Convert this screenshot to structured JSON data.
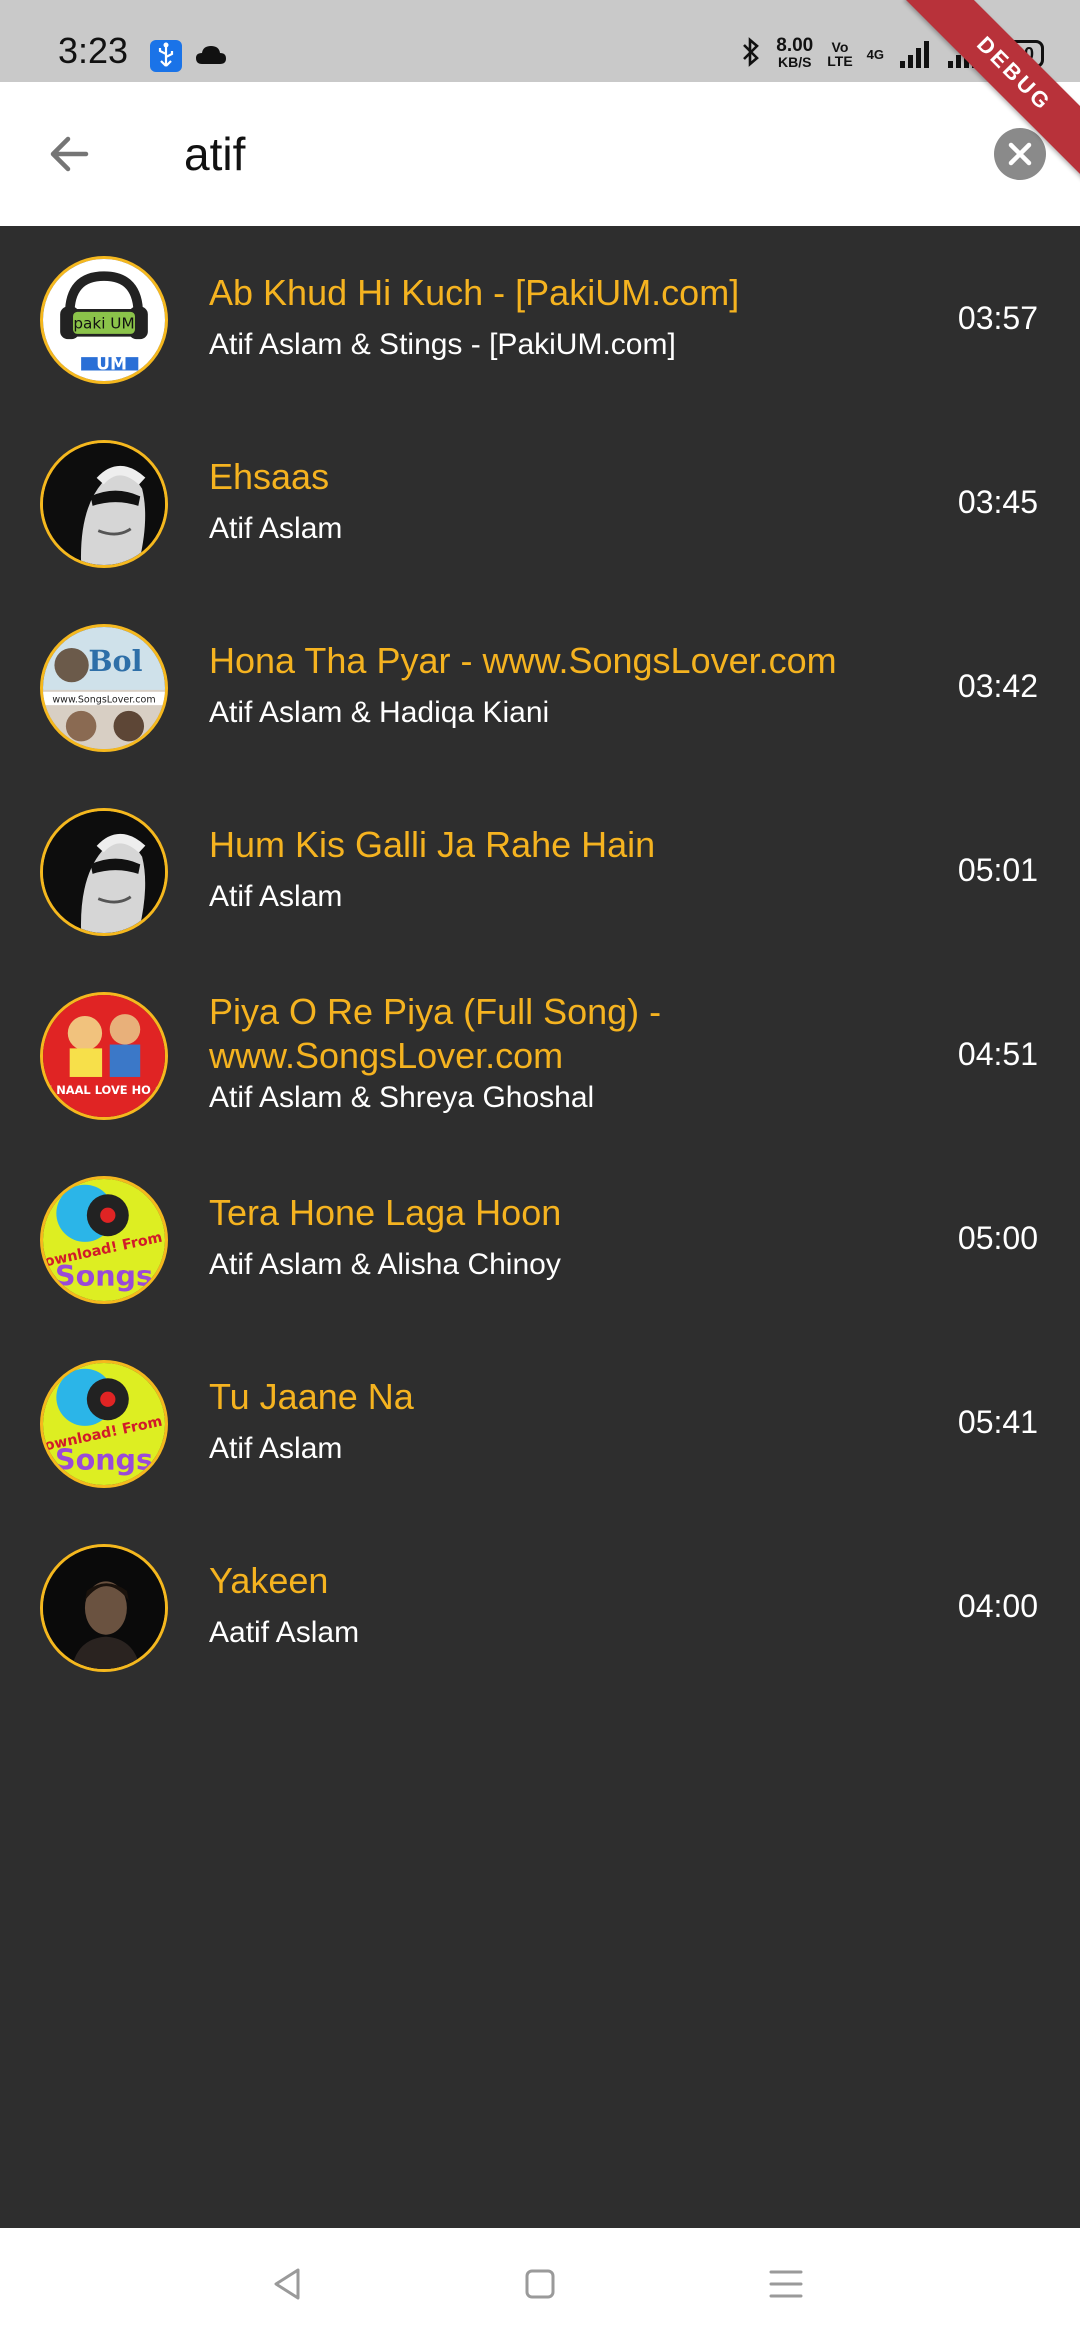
{
  "status_bar": {
    "time": "3:23",
    "speed_value": "8.00",
    "speed_unit": "KB/S",
    "volte_top": "Vo",
    "volte_bottom": "LTE",
    "network": "4G",
    "battery": "100",
    "icons": [
      "usb-icon",
      "cloud-icon",
      "bluetooth-icon",
      "signal-icon",
      "battery-icon"
    ]
  },
  "debug_banner": "DEBUG",
  "search": {
    "query": "atif",
    "back_icon": "arrow-left-icon",
    "clear_icon": "close-icon"
  },
  "songs": [
    {
      "title": "Ab Khud Hi Kuch - [PakiUM.com]",
      "artist": "Atif Aslam & Stings - [PakiUM.com]",
      "duration": "03:57",
      "art_text": "paki UM"
    },
    {
      "title": "Ehsaas",
      "artist": "Atif Aslam",
      "duration": "03:45"
    },
    {
      "title": "Hona Tha Pyar - www.SongsLover.com",
      "artist": "Atif Aslam & Hadiqa Kiani",
      "duration": "03:42",
      "art_text": "Bol"
    },
    {
      "title": "Hum Kis Galli Ja Rahe Hain",
      "artist": "Atif Aslam",
      "duration": "05:01"
    },
    {
      "title": "Piya O Re Piya (Full Song) - www.SongsLover.com",
      "artist": "Atif Aslam & Shreya Ghoshal",
      "duration": "04:51",
      "art_text": "TERE NAAL LOVE HO GAYA"
    },
    {
      "title": "Tera Hone Laga Hoon",
      "artist": "Atif Aslam & Alisha Chinoy",
      "duration": "05:00",
      "art_text": "Download! From Songs"
    },
    {
      "title": "Tu Jaane Na",
      "artist": "Atif Aslam",
      "duration": "05:41",
      "art_text": "Download! From Songs"
    },
    {
      "title": "Yakeen",
      "artist": "Aatif Aslam",
      "duration": "04:00"
    }
  ],
  "nav_bar": {
    "icons": [
      "back-triangle-icon",
      "home-square-icon",
      "menu-lines-icon"
    ]
  },
  "colors": {
    "background": "#2e2e2e",
    "title": "#f5b320",
    "artist": "#ffffff",
    "thumb_border": "#f5b81e",
    "status_bar": "#c9c9c9",
    "debug_ribbon": "#b8323a"
  }
}
